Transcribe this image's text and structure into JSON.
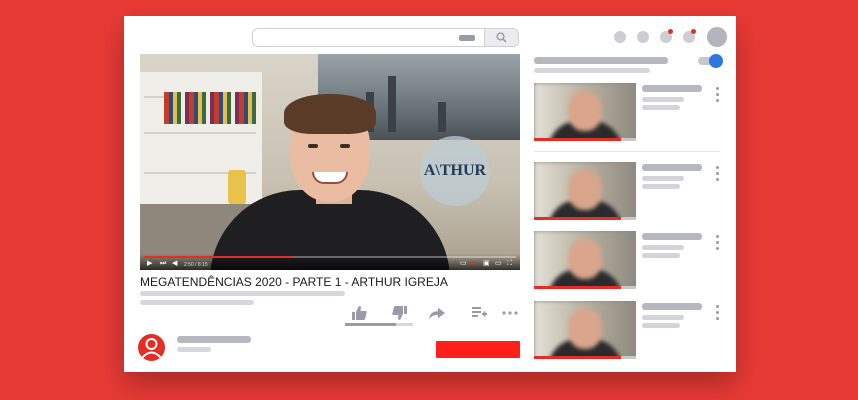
{
  "colors": {
    "background": "#e83a35",
    "accent_red": "#ff1f1a",
    "toggle_blue": "#2f76e0",
    "placeholder_gray": "#d6d6dc"
  },
  "topbar": {
    "search_icon": "search-icon",
    "notification_dots": 2
  },
  "player": {
    "wall_logo_text": "A\\THUR",
    "time_text": "2:50 / 8:15",
    "progress_fraction": 0.4
  },
  "video": {
    "title": "MEGATENDÊNCIAS 2020 - PARTE 1 - ARTHUR IGREJA",
    "actions": [
      "like-icon",
      "dislike-icon",
      "share-icon",
      "add-to-playlist-icon",
      "more-icon"
    ],
    "like_ratio": 0.75
  },
  "sidebar": {
    "autoplay_on": true,
    "recommendations": [
      {
        "progress": 0.85
      },
      {
        "progress": 0.85
      },
      {
        "progress": 0.85
      },
      {
        "progress": 0.85
      }
    ]
  }
}
